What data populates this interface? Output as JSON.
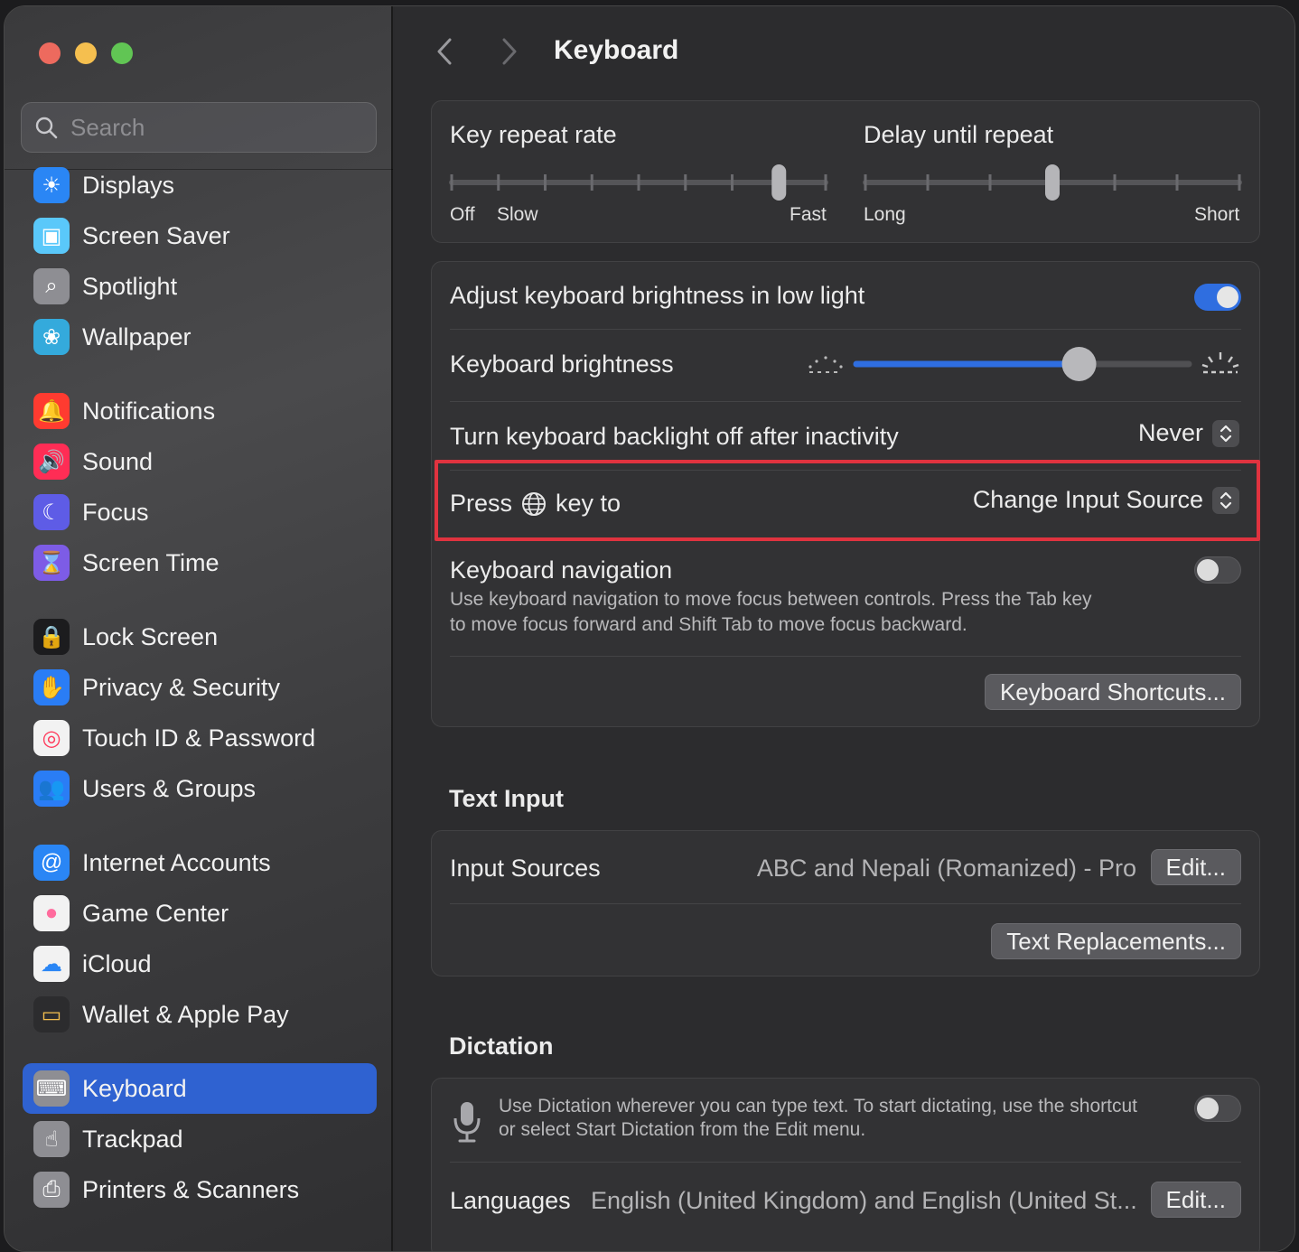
{
  "window": {
    "title": "Keyboard"
  },
  "sidebar": {
    "search_placeholder": "Search",
    "groups": [
      [
        {
          "label": "Displays",
          "icon": "displays-icon",
          "color": "#2a86f5"
        },
        {
          "label": "Screen Saver",
          "icon": "screen-saver-icon",
          "color": "#5ac8fa"
        },
        {
          "label": "Spotlight",
          "icon": "spotlight-icon",
          "color": "#8e8e93"
        },
        {
          "label": "Wallpaper",
          "icon": "wallpaper-icon",
          "color": "#34aadc"
        }
      ],
      [
        {
          "label": "Notifications",
          "icon": "notifications-icon",
          "color": "#ff3b30"
        },
        {
          "label": "Sound",
          "icon": "sound-icon",
          "color": "#ff2d55"
        },
        {
          "label": "Focus",
          "icon": "focus-icon",
          "color": "#5e5ce6"
        },
        {
          "label": "Screen Time",
          "icon": "screen-time-icon",
          "color": "#7d5ce6"
        }
      ],
      [
        {
          "label": "Lock Screen",
          "icon": "lock-screen-icon",
          "color": "#1c1c1e"
        },
        {
          "label": "Privacy & Security",
          "icon": "privacy-hand-icon",
          "color": "#2a7df5"
        },
        {
          "label": "Touch ID & Password",
          "icon": "fingerprint-icon",
          "color": "#f2f2f2"
        },
        {
          "label": "Users & Groups",
          "icon": "users-icon",
          "color": "#2a7df5"
        }
      ],
      [
        {
          "label": "Internet Accounts",
          "icon": "at-sign-icon",
          "color": "#2a86f5"
        },
        {
          "label": "Game Center",
          "icon": "game-center-icon",
          "color": "#f2f2f2"
        },
        {
          "label": "iCloud",
          "icon": "icloud-icon",
          "color": "#f2f2f2"
        },
        {
          "label": "Wallet & Apple Pay",
          "icon": "wallet-icon",
          "color": "#2c2c2e"
        }
      ],
      [
        {
          "label": "Keyboard",
          "icon": "keyboard-icon",
          "color": "#8e8e93",
          "active": true
        },
        {
          "label": "Trackpad",
          "icon": "trackpad-icon",
          "color": "#8e8e93"
        },
        {
          "label": "Printers & Scanners",
          "icon": "printer-icon",
          "color": "#8e8e93"
        }
      ]
    ]
  },
  "repeat": {
    "key_repeat_title": "Key repeat rate",
    "key_repeat_labels": [
      "Off",
      "Slow",
      "Fast"
    ],
    "key_repeat_value": 7,
    "key_repeat_steps": 8,
    "delay_title": "Delay until repeat",
    "delay_labels": [
      "Long",
      "Short"
    ],
    "delay_value": 3,
    "delay_steps": 6
  },
  "settings": {
    "adjust_brightness_label": "Adjust keyboard brightness in low light",
    "adjust_brightness_on": true,
    "brightness_label": "Keyboard brightness",
    "brightness_value": 0.67,
    "backlight_label": "Turn keyboard backlight off after inactivity",
    "backlight_value": "Never",
    "press_key_label_pre": "Press",
    "press_key_label_post": "key to",
    "press_key_value": "Change Input Source",
    "nav_label": "Keyboard navigation",
    "nav_desc_1": "Use keyboard navigation to move focus between controls. Press the Tab key",
    "nav_desc_2": "to move focus forward and Shift Tab to move focus backward.",
    "nav_on": false,
    "shortcuts_button": "Keyboard Shortcuts..."
  },
  "text_input": {
    "section_title": "Text Input",
    "input_sources_label": "Input Sources",
    "input_sources_value": "ABC and Nepali (Romanized) - Pro",
    "edit_button": "Edit...",
    "text_replacements_button": "Text Replacements..."
  },
  "dictation": {
    "section_title": "Dictation",
    "desc_1": "Use Dictation wherever you can type text. To start dictating, use the shortcut",
    "desc_2": "or select Start Dictation from the Edit menu.",
    "on": false,
    "languages_label": "Languages",
    "languages_value": "English (United Kingdom) and English (United St...",
    "edit_button": "Edit..."
  }
}
